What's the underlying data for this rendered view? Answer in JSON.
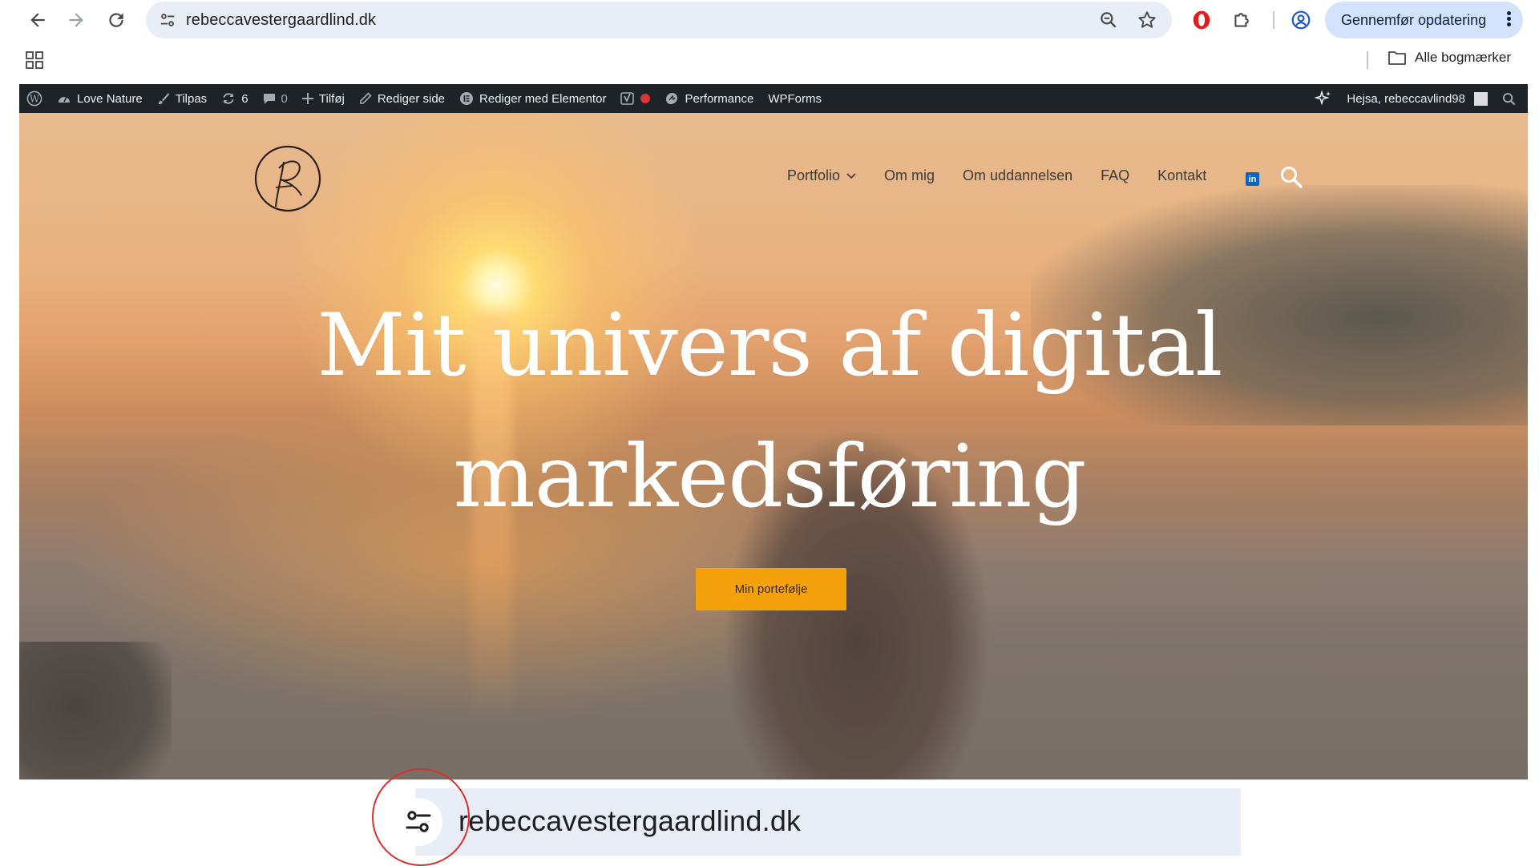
{
  "browser": {
    "url": "rebeccavestergaardlind.dk",
    "update_button": "Gennemfør opdatering",
    "bookmarks_all": "Alle bogmærker"
  },
  "icons": {
    "back": "arrow-left-icon",
    "forward": "arrow-right-icon",
    "reload": "reload-icon",
    "site_info": "tune-icon",
    "zoom": "zoom-icon",
    "bookmark": "star-icon",
    "extension_opera": "opera-icon",
    "extensions": "puzzle-icon",
    "profile": "profile-icon",
    "apps": "apps-grid-icon",
    "folder": "folder-icon"
  },
  "adminbar": {
    "site_name": "Love Nature",
    "customize": "Tilpas",
    "updates_count": "6",
    "comments_count": "0",
    "add_new": "Tilføj",
    "edit_page": "Rediger side",
    "edit_elementor": "Rediger med Elementor",
    "performance": "Performance",
    "wpforms": "WPForms",
    "greeting": "Hejsa, rebeccavlind98"
  },
  "site": {
    "nav": [
      "Portfolio",
      "Om mig",
      "Om uddannelsen",
      "FAQ",
      "Kontakt"
    ],
    "linkedin": "in",
    "hero_line1": "Mit univers af digital",
    "hero_line2": "markedsføring",
    "cta": "Min portefølje"
  },
  "callout": {
    "url": "rebeccavestergaardlind.dk"
  },
  "colors": {
    "admin_bar": "#1d2327",
    "cta": "#f4a10b",
    "omnibox": "#e9eef6",
    "update_button": "#d3e3fd",
    "highlight_ring": "#d9302c"
  }
}
